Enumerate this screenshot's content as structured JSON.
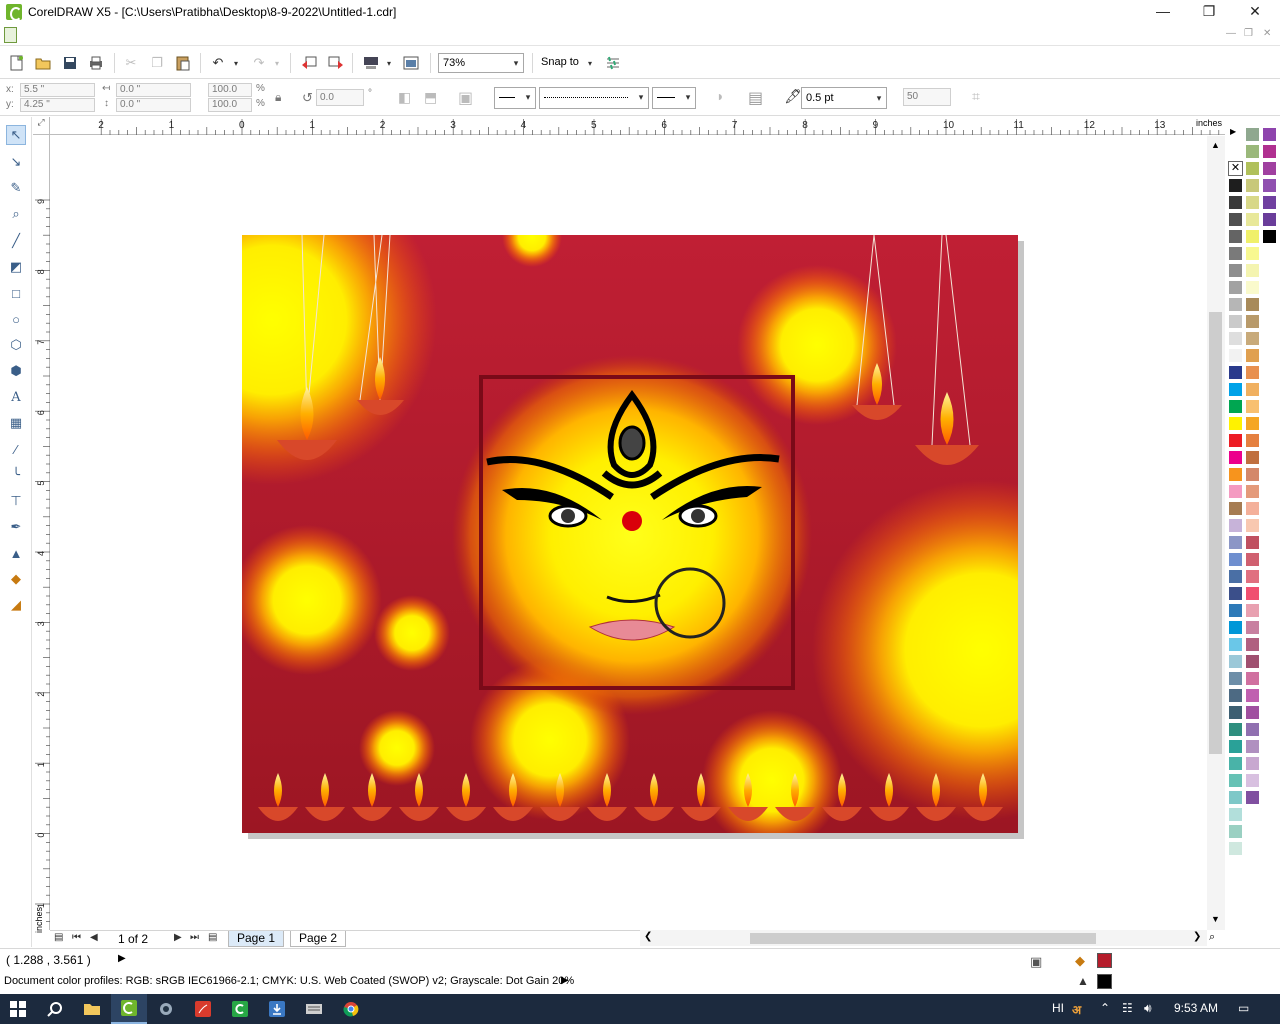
{
  "window": {
    "title": "CorelDRAW X5 - [C:\\Users\\Pratibha\\Desktop\\8-9-2022\\Untitled-1.cdr]",
    "controls": [
      "minimize",
      "restore",
      "close"
    ]
  },
  "toolbar": {
    "zoom_value": "73%",
    "snap_to_label": "Snap to",
    "icons": [
      "new-icon",
      "open-icon",
      "save-icon",
      "print-icon",
      "cut-icon",
      "copy-icon",
      "paste-icon",
      "undo-icon",
      "redo-icon",
      "import-icon",
      "export-icon",
      "application-launcher-icon",
      "welcome-screen-icon",
      "options-icon"
    ]
  },
  "property_bar": {
    "x": "5.5 \"",
    "y": "4.25 \"",
    "x_label": "x:",
    "y_label": "y:",
    "width": "0.0 \"",
    "height": "0.0 \"",
    "scale_x": "100.0",
    "scale_y": "100.0",
    "percent": "%",
    "rotation": "0.0",
    "degree": "°",
    "outline_width": "0.5 pt",
    "nudge": "50"
  },
  "rulers": {
    "unit": "inches",
    "h_ticks": [
      "2",
      "1",
      "0",
      "1",
      "2",
      "3",
      "4",
      "5",
      "6",
      "7",
      "8",
      "9",
      "10",
      "11",
      "12",
      "13"
    ],
    "v_ticks": [
      "9",
      "8",
      "7",
      "6",
      "5",
      "4",
      "3",
      "2",
      "1",
      "0",
      "1"
    ],
    "v_unit": "inches"
  },
  "pages": {
    "indicator": "1 of 2",
    "tabs": [
      "Page 1",
      "Page 2"
    ],
    "active_tab": 0
  },
  "palette": {
    "column_a": [
      "#1e1e1e",
      "#3a3a3a",
      "#505050",
      "#646464",
      "#7a7a7a",
      "#8e8e8e",
      "#a2a2a2",
      "#b6b6b6",
      "#cacaca",
      "#dedede",
      "#f2f2f2",
      "#2a3a8c",
      "#00a2e8",
      "#00a651",
      "#fff200",
      "#ed1c24",
      "#ec008c",
      "#f7941d",
      "#f49ac1",
      "#a67c52",
      "#c7b3d9",
      "#8c96c6",
      "#6f8fcf",
      "#4a6fa5",
      "#3b4f8a",
      "#2e7ab8",
      "#0097d8",
      "#6ac7e8",
      "#9bc8d8",
      "#6d8ea8",
      "#4d6a83",
      "#3d5f72",
      "#2f8f7f",
      "#2aa198",
      "#49b3a8",
      "#66c2b5",
      "#7ec8c8",
      "#b2dfdb",
      "#9ad0c2",
      "#cfe8df"
    ],
    "column_b": [
      "#8fa88f",
      "#9ab87a",
      "#b0c05a",
      "#c8c87a",
      "#d8d888",
      "#e8e89a",
      "#f0f06a",
      "#f8f890",
      "#f4f4b0",
      "#fafacc",
      "#a88a5a",
      "#b89a6a",
      "#c8aa7a",
      "#e0a050",
      "#e89050",
      "#f0b060",
      "#f8c070",
      "#f5a623",
      "#e58040",
      "#c07040",
      "#d4886a",
      "#e49a7a",
      "#f4b09a",
      "#f8c8b0",
      "#c05060",
      "#d06070",
      "#e07080",
      "#f05070",
      "#e8a0b0",
      "#c880a0",
      "#b06080",
      "#a05070",
      "#d070a0",
      "#c060b0",
      "#a050a0",
      "#9070b0",
      "#b090c0",
      "#c8a8d0",
      "#d8c0e0",
      "#8050a0"
    ],
    "column_c": [
      "#8e44ad",
      "#b03090",
      "#a040a0",
      "#9050b0",
      "#7040a0",
      "#6a3d9a",
      "#000000"
    ]
  },
  "status": {
    "cursor_coords": "( 1.288 , 3.561 )",
    "color_profiles": "Document color profiles: RGB: sRGB IEC61966-2.1; CMYK: U.S. Web Coated (SWOP) v2; Grayscale: Dot Gain 20%",
    "fill_color": "#b51c2b",
    "outline_color": "#000000"
  },
  "taskbar": {
    "apps": [
      "start-icon",
      "search-icon",
      "file-explorer-icon",
      "coreldraw-icon",
      "corel-capture-icon",
      "adobe-acrobat-icon",
      "camtasia-icon",
      "downloads-icon",
      "keyboard-icon",
      "chrome-icon"
    ],
    "language": "HI",
    "time": "9:53 AM"
  }
}
